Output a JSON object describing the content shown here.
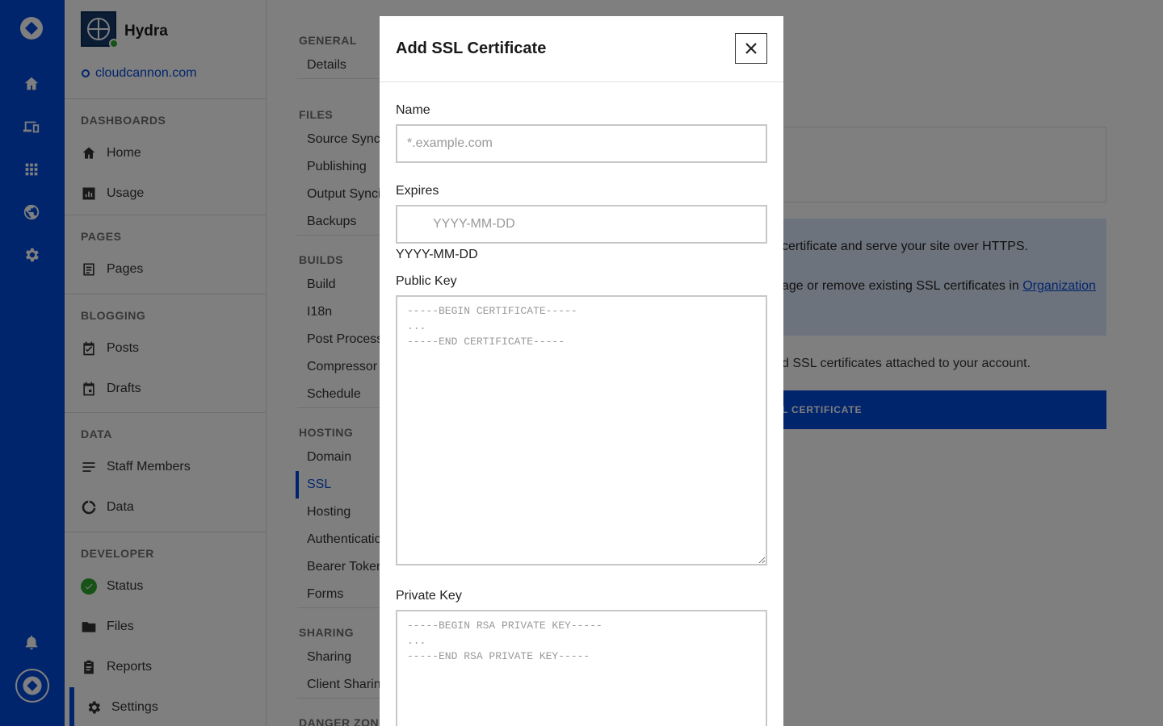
{
  "rail": {
    "icons": [
      "cloudcannon-logo-icon",
      "home-icon",
      "devices-icon",
      "apps-grid-icon",
      "globe-icon",
      "gear-icon",
      "bell-icon",
      "avatar-logo-icon"
    ]
  },
  "site": {
    "name": "Hydra",
    "domain": "cloudcannon.com"
  },
  "sidebar": {
    "sections": [
      {
        "heading": "DASHBOARDS",
        "items": [
          {
            "label": "Home",
            "icon": "home-icon"
          },
          {
            "label": "Usage",
            "icon": "bar-chart-icon"
          }
        ]
      },
      {
        "heading": "PAGES",
        "items": [
          {
            "label": "Pages",
            "icon": "page-icon"
          }
        ]
      },
      {
        "heading": "BLOGGING",
        "items": [
          {
            "label": "Posts",
            "icon": "calendar-check-icon"
          },
          {
            "label": "Drafts",
            "icon": "calendar-icon"
          }
        ]
      },
      {
        "heading": "DATA",
        "items": [
          {
            "label": "Staff Members",
            "icon": "list-icon"
          },
          {
            "label": "Data",
            "icon": "donut-icon"
          }
        ]
      },
      {
        "heading": "DEVELOPER",
        "items": [
          {
            "label": "Status",
            "icon": "check-circle-icon"
          },
          {
            "label": "Files",
            "icon": "folder-icon"
          },
          {
            "label": "Reports",
            "icon": "clipboard-icon"
          },
          {
            "label": "Settings",
            "icon": "gear-icon"
          }
        ]
      }
    ]
  },
  "settings_nav": {
    "general": {
      "heading": "GENERAL",
      "items": [
        "Details"
      ]
    },
    "files": {
      "heading": "FILES",
      "items": [
        "Source Syncing",
        "Publishing",
        "Output Syncing",
        "Backups"
      ]
    },
    "builds": {
      "heading": "BUILDS",
      "items": [
        "Build",
        "I18n",
        "Post Processing",
        "Compressor",
        "Schedule"
      ]
    },
    "hosting": {
      "heading": "HOSTING",
      "items": [
        "Domain",
        "SSL",
        "Hosting",
        "Authentication",
        "Bearer Tokens",
        "Forms"
      ]
    },
    "sharing": {
      "heading": "SHARING",
      "items": [
        "Sharing",
        "Client Sharing"
      ]
    },
    "danger": {
      "heading": "DANGER ZONE"
    }
  },
  "main": {
    "info_line1": "certificate and serve your site over HTTPS.",
    "info_line2_prefix": "age or remove existing SSL certificates in ",
    "info_link": "Organization",
    "note": "d SSL certificates attached to your account.",
    "button_label": "L CERTIFICATE"
  },
  "modal": {
    "title": "Add SSL Certificate",
    "name_label": "Name",
    "name_placeholder": "*.example.com",
    "name_value": "",
    "expires_label": "Expires",
    "expires_placeholder": "YYYY-MM-DD",
    "expires_value": "",
    "expires_hint": "YYYY-MM-DD",
    "public_key_label": "Public Key",
    "public_key_placeholder": "-----BEGIN CERTIFICATE-----\n...\n-----END CERTIFICATE-----",
    "public_key_value": "",
    "private_key_label": "Private Key",
    "private_key_placeholder": "-----BEGIN RSA PRIVATE KEY-----\n...\n-----END RSA PRIVATE KEY-----",
    "private_key_value": ""
  },
  "colors": {
    "brand": "#034ad8",
    "status_ok": "#2ea52e",
    "info_bg": "#dbe6fb"
  }
}
